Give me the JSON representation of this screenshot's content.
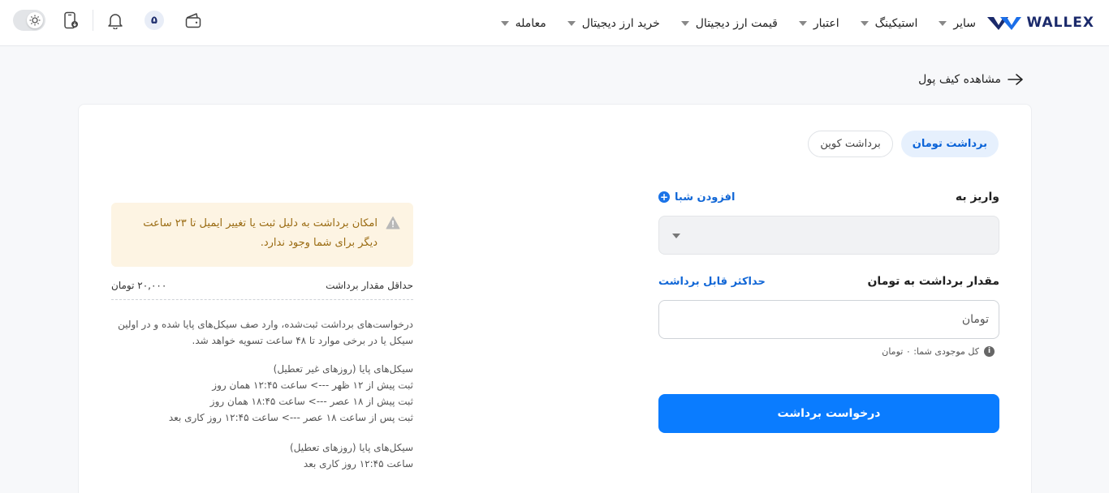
{
  "header": {
    "logo_text": "WALLEX",
    "nav": [
      {
        "label": "معامله"
      },
      {
        "label": "خرید ارز دیجیتال"
      },
      {
        "label": "قیمت ارز دیجیتال"
      },
      {
        "label": "اعتبار"
      },
      {
        "label": "استیکینگ"
      },
      {
        "label": "سایر"
      }
    ],
    "notification_count": "۵"
  },
  "back_link": "مشاهده کیف پول",
  "tabs": {
    "toman": "برداشت تومان",
    "coin": "برداشت کوین"
  },
  "form": {
    "deposit_to_label": "واریز به",
    "add_sheba": "افزودن شبا",
    "amount_label": "مقدار برداشت به تومان",
    "max_withdraw": "حداکثر قابل برداشت",
    "amount_placeholder": "تومان",
    "balance_text": "کل موجودی شما: ۰ تومان",
    "submit": "درخواست برداشت"
  },
  "info": {
    "warning": "امکان برداشت به دلیل ثبت یا تغییر ایمیل تا ۲۳ ساعت دیگر برای شما وجود ندارد.",
    "min_label": "حداقل مقدار برداشت",
    "min_value": "۲۰,۰۰۰ تومان",
    "desc": "درخواست‌های برداشت ثبت‌شده، وارد صف سیکل‌های پایا شده و در اولین سیکل یا در برخی موارد تا ۴۸ ساعت تسویه خواهد شد.",
    "nonholiday_title": "سیکل‌های پایا (روزهای غیر تعطیل)",
    "nonholiday_lines": [
      "ثبت پیش از ۱۲ ظهر ---> ساعت ۱۲:۴۵ همان روز",
      "ثبت پیش از ۱۸ عصر ---> ساعت ۱۸:۴۵ همان روز",
      "ثبت پس از ساعت ۱۸ عصر ---> ساعت ۱۲:۴۵ روز کاری بعد"
    ],
    "holiday_title": "سیکل‌های پایا (روزهای تعطیل)",
    "holiday_line": "ساعت ۱۲:۴۵ روز کاری بعد"
  },
  "colors": {
    "primary": "#0a7cff",
    "link": "#1066d6",
    "warning_bg": "#fdf4e3",
    "warning_text": "#9a6b12"
  }
}
